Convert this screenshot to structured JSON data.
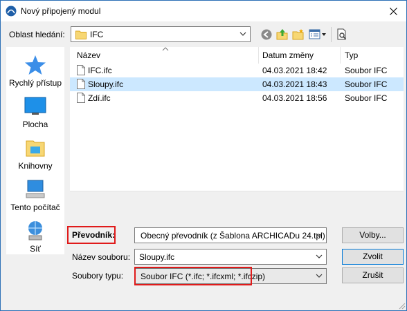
{
  "window": {
    "title": "Nový připojený modul"
  },
  "location": {
    "label": "Oblast hledání:",
    "value": "IFC"
  },
  "toolbar_icons": [
    "back-icon",
    "up-folder-icon",
    "new-folder-icon",
    "view-menu-icon",
    "preview-icon"
  ],
  "places": [
    {
      "label": "Rychlý přístup",
      "icon": "star-icon"
    },
    {
      "label": "Plocha",
      "icon": "desktop-icon"
    },
    {
      "label": "Knihovny",
      "icon": "library-icon"
    },
    {
      "label": "Tento počítač",
      "icon": "computer-icon"
    },
    {
      "label": "Síť",
      "icon": "network-icon"
    }
  ],
  "file_list": {
    "columns": [
      "Název",
      "Datum změny",
      "Typ"
    ],
    "rows": [
      {
        "name": "IFC.ifc",
        "date": "04.03.2021 18:42",
        "type": "Soubor IFC",
        "selected": false
      },
      {
        "name": "Sloupy.ifc",
        "date": "04.03.2021 18:43",
        "type": "Soubor IFC",
        "selected": true
      },
      {
        "name": "Zdí.ifc",
        "date": "04.03.2021 18:56",
        "type": "Soubor IFC",
        "selected": false
      }
    ]
  },
  "form": {
    "translator_label": "Převodník:",
    "translator_value": "Obecný převodník (z Šablona ARCHICADu 24.tpl)",
    "options_button": "Volby...",
    "filename_label": "Název souboru:",
    "filename_value": "Sloupy.ifc",
    "filetype_label": "Soubory typu:",
    "filetype_value": "Soubor IFC (*.ifc; *.ifcxml; *.ifczip)",
    "choose_button": "Zvolit",
    "cancel_button": "Zrušit"
  },
  "colors": {
    "selection": "#cce8ff",
    "highlight_box": "#e01a1a",
    "accent": "#0078d7"
  }
}
